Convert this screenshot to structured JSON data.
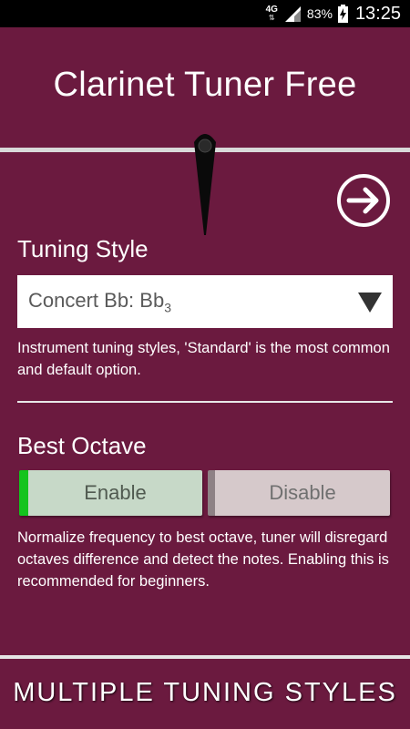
{
  "status_bar": {
    "network": "4G",
    "battery": "83%",
    "time": "13:25"
  },
  "app": {
    "title": "Clarinet Tuner Free"
  },
  "icons": {
    "next": "arrow-right-circle-icon",
    "dropdown": "triangle-down-icon",
    "signal": "cell-signal-icon",
    "battery": "battery-charging-icon"
  },
  "tuning_style": {
    "label": "Tuning Style",
    "selected_prefix": "Concert Bb: Bb",
    "selected_subscript": "3",
    "help": "Instrument tuning styles, 'Standard' is the most common and default option."
  },
  "best_octave": {
    "label": "Best Octave",
    "enable_label": "Enable",
    "disable_label": "Disable",
    "selected": "Enable",
    "help": "Normalize frequency to best octave, tuner will disregard octaves difference and detect the notes. Enabling this is recommended for beginners."
  },
  "footer": {
    "banner": "MULTIPLE TUNING STYLES"
  },
  "colors": {
    "background": "#6b1a3f",
    "enable_accent": "#14c41d"
  }
}
